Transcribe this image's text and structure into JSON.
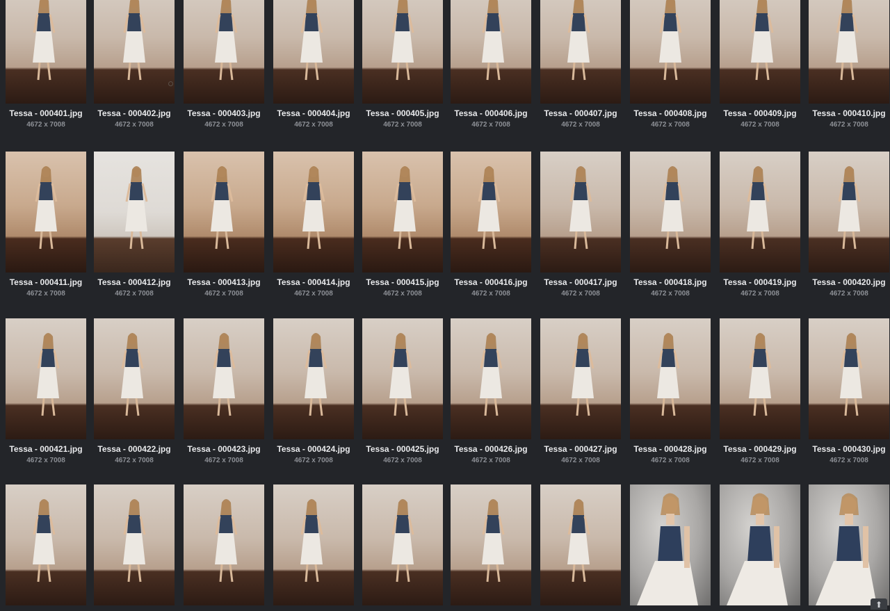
{
  "gallery": {
    "images": [
      {
        "filename": "Tessa - 000401.jpg",
        "dimensions": "4672 x 7008"
      },
      {
        "filename": "Tessa - 000402.jpg",
        "dimensions": "4672 x 7008"
      },
      {
        "filename": "Tessa - 000403.jpg",
        "dimensions": "4672 x 7008"
      },
      {
        "filename": "Tessa - 000404.jpg",
        "dimensions": "4672 x 7008"
      },
      {
        "filename": "Tessa - 000405.jpg",
        "dimensions": "4672 x 7008"
      },
      {
        "filename": "Tessa - 000406.jpg",
        "dimensions": "4672 x 7008"
      },
      {
        "filename": "Tessa - 000407.jpg",
        "dimensions": "4672 x 7008"
      },
      {
        "filename": "Tessa - 000408.jpg",
        "dimensions": "4672 x 7008"
      },
      {
        "filename": "Tessa - 000409.jpg",
        "dimensions": "4672 x 7008"
      },
      {
        "filename": "Tessa - 000410.jpg",
        "dimensions": "4672 x 7008"
      },
      {
        "filename": "Tessa - 000411.jpg",
        "dimensions": "4672 x 7008"
      },
      {
        "filename": "Tessa - 000412.jpg",
        "dimensions": "4672 x 7008"
      },
      {
        "filename": "Tessa - 000413.jpg",
        "dimensions": "4672 x 7008"
      },
      {
        "filename": "Tessa - 000414.jpg",
        "dimensions": "4672 x 7008"
      },
      {
        "filename": "Tessa - 000415.jpg",
        "dimensions": "4672 x 7008"
      },
      {
        "filename": "Tessa - 000416.jpg",
        "dimensions": "4672 x 7008"
      },
      {
        "filename": "Tessa - 000417.jpg",
        "dimensions": "4672 x 7008"
      },
      {
        "filename": "Tessa - 000418.jpg",
        "dimensions": "4672 x 7008"
      },
      {
        "filename": "Tessa - 000419.jpg",
        "dimensions": "4672 x 7008"
      },
      {
        "filename": "Tessa - 000420.jpg",
        "dimensions": "4672 x 7008"
      },
      {
        "filename": "Tessa - 000421.jpg",
        "dimensions": "4672 x 7008"
      },
      {
        "filename": "Tessa - 000422.jpg",
        "dimensions": "4672 x 7008"
      },
      {
        "filename": "Tessa - 000423.jpg",
        "dimensions": "4672 x 7008"
      },
      {
        "filename": "Tessa - 000424.jpg",
        "dimensions": "4672 x 7008"
      },
      {
        "filename": "Tessa - 000425.jpg",
        "dimensions": "4672 x 7008"
      },
      {
        "filename": "Tessa - 000426.jpg",
        "dimensions": "4672 x 7008"
      },
      {
        "filename": "Tessa - 000427.jpg",
        "dimensions": "4672 x 7008"
      },
      {
        "filename": "Tessa - 000428.jpg",
        "dimensions": "4672 x 7008"
      },
      {
        "filename": "Tessa - 000429.jpg",
        "dimensions": "4672 x 7008"
      },
      {
        "filename": "Tessa - 000430.jpg",
        "dimensions": "4672 x 7008"
      },
      {
        "filename": "",
        "dimensions": ""
      },
      {
        "filename": "",
        "dimensions": ""
      },
      {
        "filename": "",
        "dimensions": ""
      },
      {
        "filename": "",
        "dimensions": ""
      },
      {
        "filename": "",
        "dimensions": ""
      },
      {
        "filename": "",
        "dimensions": ""
      },
      {
        "filename": "",
        "dimensions": ""
      },
      {
        "filename": "",
        "dimensions": ""
      },
      {
        "filename": "",
        "dimensions": ""
      },
      {
        "filename": "",
        "dimensions": ""
      }
    ]
  },
  "colors": {
    "background": "#232529",
    "filename_text": "#e9eaec",
    "dimensions_text": "#8d9096"
  },
  "icons": {
    "scroll_top": "arrow-up-icon"
  },
  "scroll_top_glyph": "⬆"
}
